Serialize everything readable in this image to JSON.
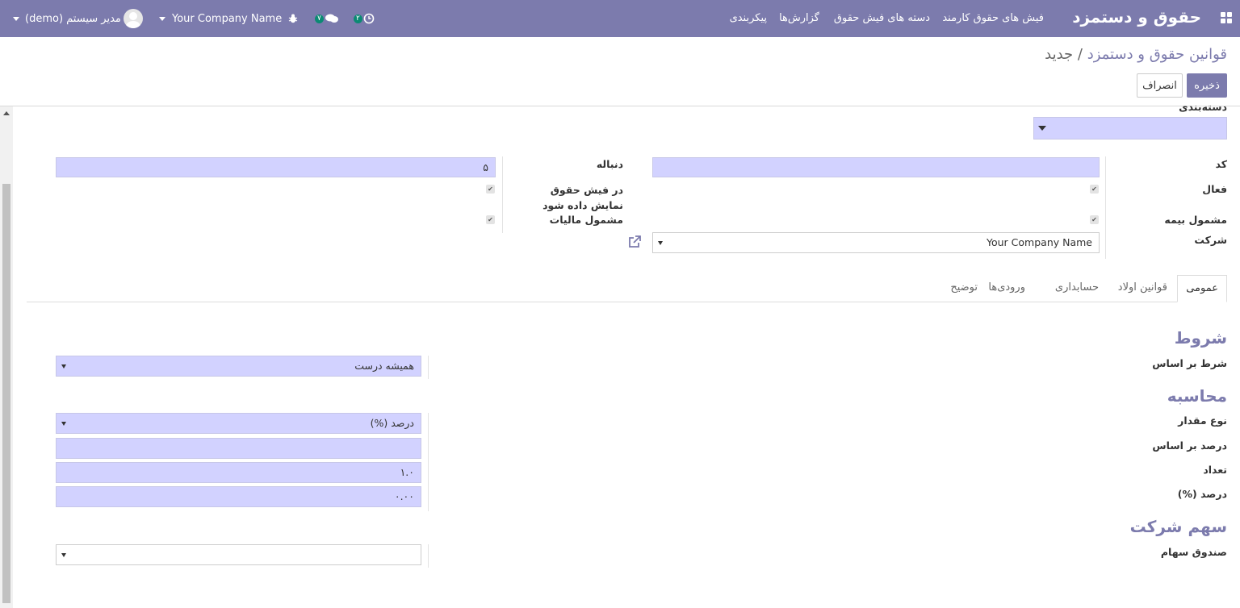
{
  "navbar": {
    "app_title": "حقوق و دستمزد",
    "menu": [
      "فیش های حقوق کارمند",
      "دسته های فیش حقوق",
      "گزارش‌ها",
      "پیکربندی"
    ],
    "activity_badge": "۲",
    "messages_badge": "۷",
    "company_switcher": "Your Company Name",
    "user_name": "مدیر سیستم (demo)"
  },
  "control_panel": {
    "breadcrumb_parent": "قوانین حقوق و دستمزد",
    "breadcrumb_separator": " / ",
    "breadcrumb_current": "جدید",
    "save_label": "ذخیره",
    "discard_label": "انصراف"
  },
  "form": {
    "category_label": "دسته‌بندی",
    "category_value": "",
    "code_label": "کد",
    "code_value": "",
    "sequence_label": "دنباله",
    "sequence_value": "۵",
    "active_label": "فعال",
    "active_checked": true,
    "appears_on_payslip_label": "در فیش حقوق نمایش داده شود",
    "appears_on_payslip_checked": true,
    "insurance_label": "مشمول بیمه",
    "insurance_checked": true,
    "tax_label": "مشمول مالیات",
    "tax_checked": true,
    "company_label": "شرکت",
    "company_value": "Your Company Name"
  },
  "tabs": [
    "عمومی",
    "قوانین اولاد",
    "حسابداری",
    "ورودی‌ها",
    "توضیح"
  ],
  "general_tab": {
    "conditions_title": "شروط",
    "condition_based_on_label": "شرط بر اساس",
    "condition_based_on_value": "همیشه درست",
    "computation_title": "محاسبه",
    "amount_type_label": "نوع مقدار",
    "amount_type_value": "درصد (%)",
    "percentage_based_on_label": "درصد بر اساس",
    "percentage_based_on_value": "",
    "quantity_label": "تعداد",
    "quantity_value": "۱.۰",
    "percentage_label": "درصد (%)",
    "percentage_value": "۰.۰۰",
    "company_contribution_title": "سهم شرکت",
    "contribution_register_label": "صندوق سهام",
    "contribution_register_value": ""
  },
  "colors": {
    "brand": "#7c7bad",
    "required_field": "#d2d2ff",
    "badge": "#0b8a73"
  }
}
